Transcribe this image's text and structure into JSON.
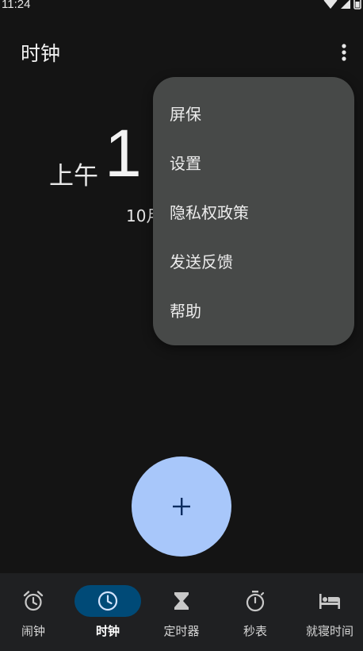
{
  "status_bar": {
    "time": "11:24"
  },
  "app_bar": {
    "title": "时钟",
    "overflow_icon": "more-vert-icon"
  },
  "clock": {
    "ampm": "上午",
    "time_visible": "1",
    "date_visible": "10月"
  },
  "menu": {
    "items": [
      {
        "label": "屏保"
      },
      {
        "label": "设置"
      },
      {
        "label": "隐私权政策"
      },
      {
        "label": "发送反馈"
      },
      {
        "label": "帮助"
      }
    ]
  },
  "fab": {
    "icon": "add-icon"
  },
  "bottom_nav": {
    "active_index": 1,
    "items": [
      {
        "label": "闹钟",
        "icon": "alarm-icon"
      },
      {
        "label": "时钟",
        "icon": "clock-icon"
      },
      {
        "label": "定时器",
        "icon": "hourglass-icon"
      },
      {
        "label": "秒表",
        "icon": "stopwatch-icon"
      },
      {
        "label": "就寝时间",
        "icon": "bed-icon"
      }
    ]
  },
  "colors": {
    "background": "#141414",
    "menu_background": "#474948",
    "fab_background": "#a8c7fa",
    "fab_icon": "#0b2c5f",
    "nav_background": "#1f2022",
    "nav_active_pill": "#004a77",
    "nav_active_icon": "#d3e3fd"
  }
}
